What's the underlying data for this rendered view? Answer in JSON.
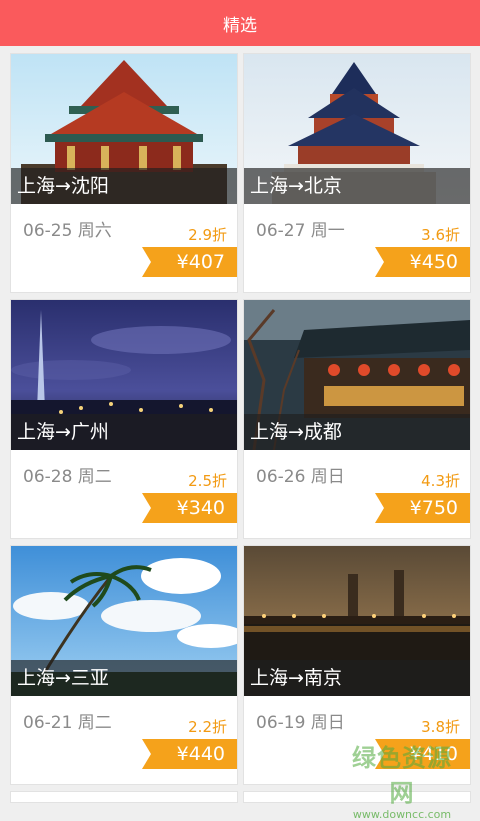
{
  "header": {
    "title": "精选"
  },
  "cards": [
    {
      "route": "上海→沈阳",
      "date": "06-25 周六",
      "discount": "2.9折",
      "price": "¥407"
    },
    {
      "route": "上海→北京",
      "date": "06-27 周一",
      "discount": "3.6折",
      "price": "¥450"
    },
    {
      "route": "上海→广州",
      "date": "06-28 周二",
      "discount": "2.5折",
      "price": "¥340"
    },
    {
      "route": "上海→成都",
      "date": "06-26 周日",
      "discount": "4.3折",
      "price": "¥750"
    },
    {
      "route": "上海→三亚",
      "date": "06-21 周二",
      "discount": "2.2折",
      "price": "¥440"
    },
    {
      "route": "上海→南京",
      "date": "06-19 周日",
      "discount": "3.8折",
      "price": "¥410"
    }
  ],
  "watermark": {
    "main": "绿色资源网",
    "sub": "www.downcc.com"
  }
}
